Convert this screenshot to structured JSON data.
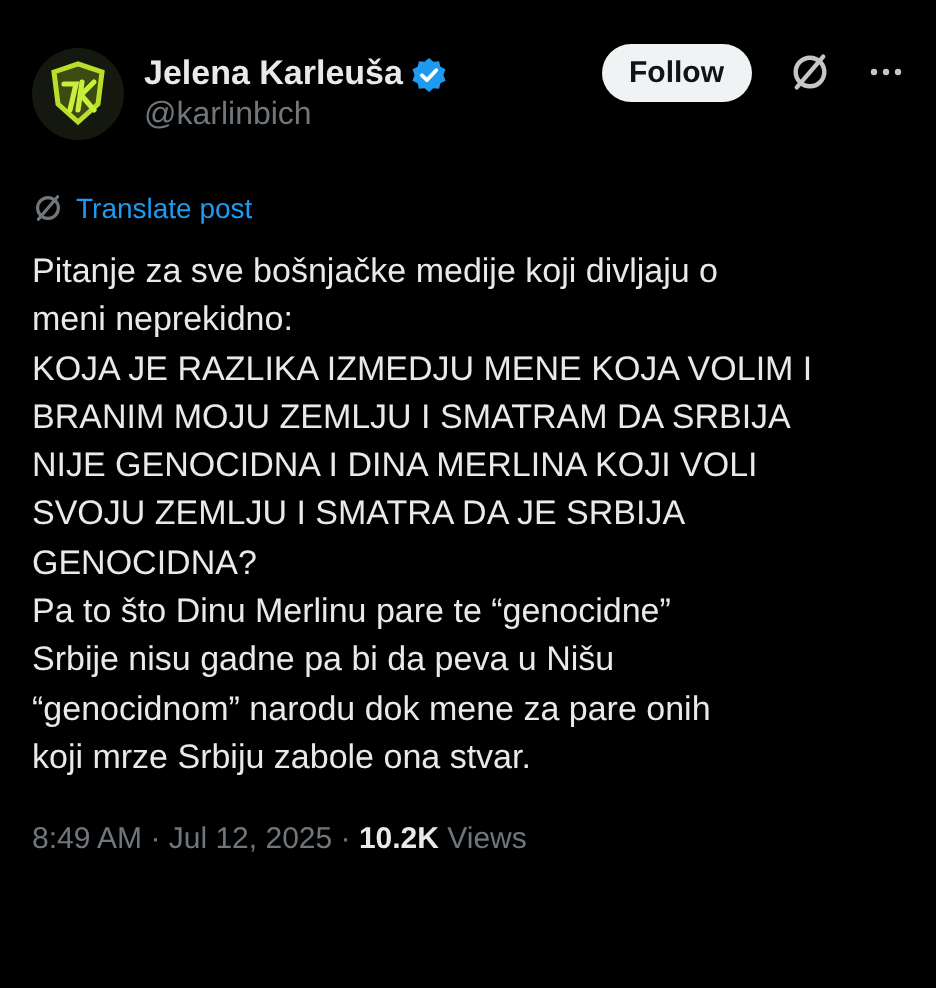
{
  "author": {
    "name": "Jelena Karleuša",
    "handle": "@karlinbich",
    "verified": true
  },
  "follow_button": {
    "label": "Follow"
  },
  "translate_link": {
    "label": "Translate post"
  },
  "post": {
    "lines": [
      "Pitanje za sve bošnjačke medije koji divljaju o",
      "meni neprekidno:",
      "KOJA JE RAZLIKA IZMEDJU MENE KOJA VOLIM I",
      "BRANIM MOJU ZEMLJU I SMATRAM DA SRBIJA",
      "NIJE GENOCIDNA I DINA MERLINA KOJI VOLI",
      "SVOJU ZEMLJU I SMATRA DA JE SRBIJA",
      "GENOCIDNA?",
      "Pa to što Dinu Merlinu pare te “genocidne”",
      "Srbije nisu gadne pa bi da peva u Nišu",
      "“genocidnom” narodu dok mene za pare onih",
      "koji mrze Srbiju zabole ona stvar."
    ]
  },
  "meta": "8:49 AM · Jul 12, 2025 · **10.2K** Views"
}
